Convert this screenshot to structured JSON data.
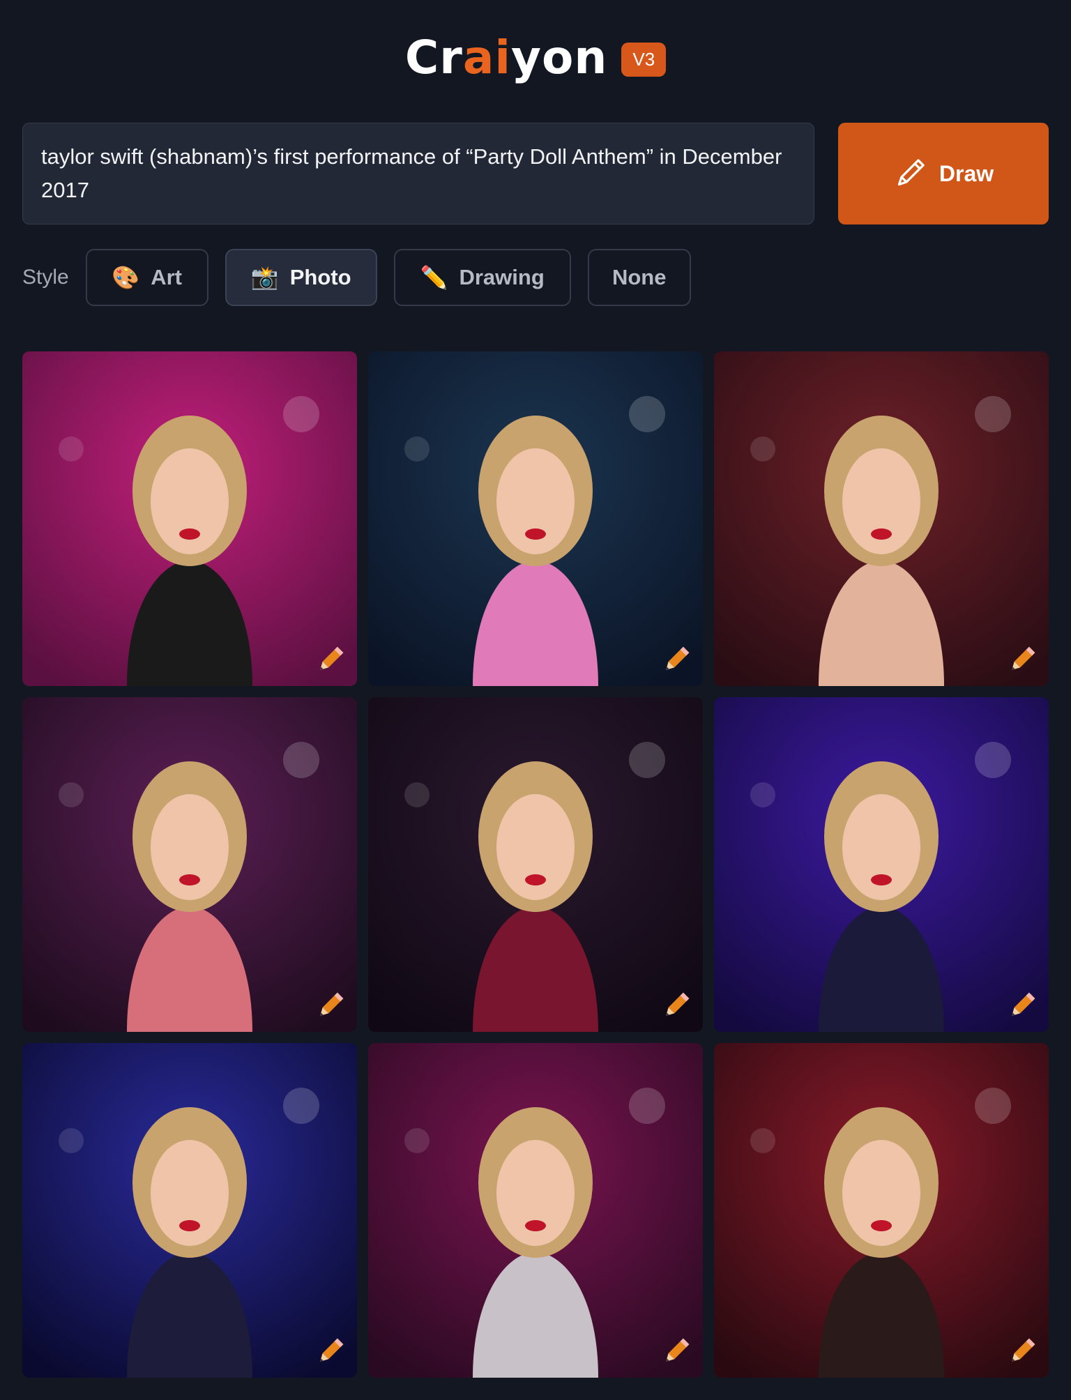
{
  "header": {
    "logo_parts": [
      "Cr",
      "ai",
      "yon"
    ],
    "version_badge": "V3"
  },
  "prompt": {
    "value": "taylor swift (shabnam)’s first performance of “Party Doll Anthem” in December 2017"
  },
  "draw_button": {
    "label": "Draw",
    "icon": "pencil-icon"
  },
  "style": {
    "label": "Style",
    "options": [
      {
        "label": "Art",
        "icon": "🎨",
        "selected": false
      },
      {
        "label": "Photo",
        "icon": "📸",
        "selected": true
      },
      {
        "label": "Drawing",
        "icon": "✏️",
        "selected": false
      },
      {
        "label": "None",
        "icon": "",
        "selected": false
      }
    ]
  },
  "colors": {
    "background": "#131722",
    "accent": "#d15718",
    "panel": "#232837"
  },
  "results": [
    {
      "id": 1,
      "bg": [
        "#c21f7a",
        "#5a1040"
      ],
      "dress": "#1a1a1a"
    },
    {
      "id": 2,
      "bg": [
        "#1b3550",
        "#0b1426"
      ],
      "dress": "#e07ab8"
    },
    {
      "id": 3,
      "bg": [
        "#6e2028",
        "#2a0d14"
      ],
      "dress": "#e2b39a"
    },
    {
      "id": 4,
      "bg": [
        "#5c1f55",
        "#1e0c1e"
      ],
      "dress": "#d66f7a"
    },
    {
      "id": 5,
      "bg": [
        "#2a1a2e",
        "#100814"
      ],
      "dress": "#7a1530"
    },
    {
      "id": 6,
      "bg": [
        "#3c1aa0",
        "#140a40"
      ],
      "dress": "#1c1a3a"
    },
    {
      "id": 7,
      "bg": [
        "#2a2a9a",
        "#0a0a30"
      ],
      "dress": "#1d1c3a"
    },
    {
      "id": 8,
      "bg": [
        "#7a1450",
        "#2a0a22"
      ],
      "dress": "#c8c2c8"
    },
    {
      "id": 9,
      "bg": [
        "#8a1a2a",
        "#2a0a10"
      ],
      "dress": "#2a1a1a"
    }
  ]
}
